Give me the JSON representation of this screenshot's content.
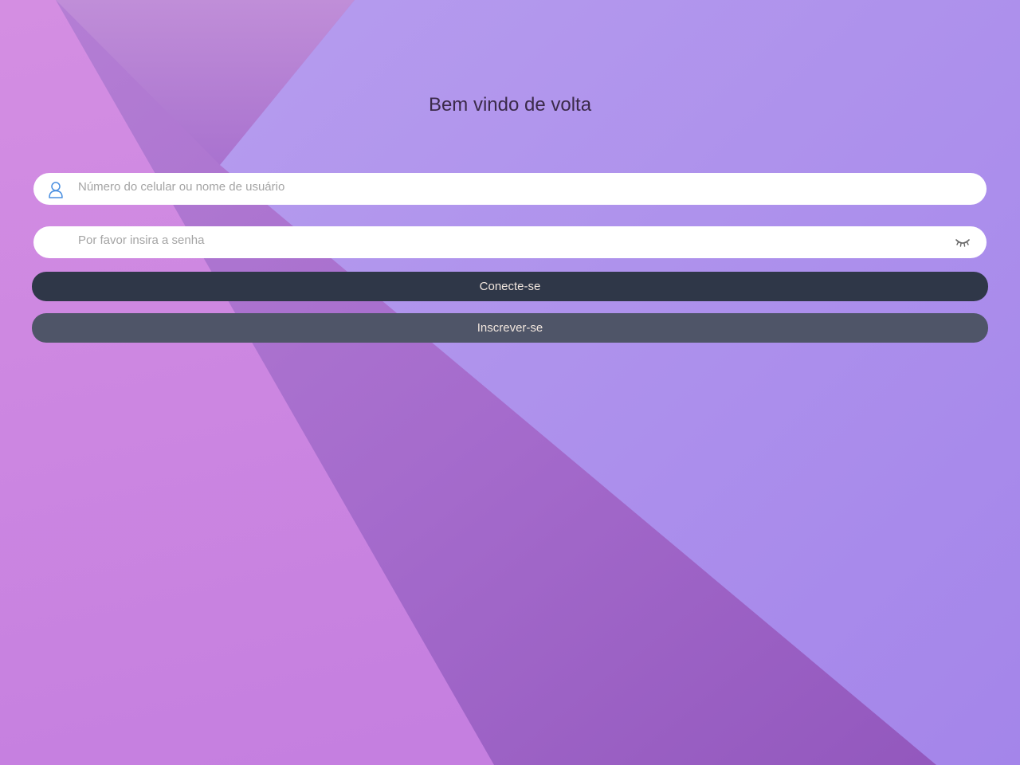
{
  "login": {
    "title": "Bem vindo de volta",
    "username_placeholder": "Número do celular ou nome de usuário",
    "username_value": "",
    "password_placeholder": "Por favor insira a senha",
    "password_value": "",
    "login_label": "Conecte-se",
    "signup_label": "Inscrever-se"
  },
  "icons": {
    "username": "user-icon",
    "password_toggle": "eye-closed-icon"
  },
  "colors": {
    "login_button": "#2f3748",
    "signup_button": "#4f5568",
    "button_text": "#f1e6de",
    "title_text": "#3b2a4a",
    "icon_accent": "#4a8fe0",
    "background_left": "#d08ce0",
    "background_right": "#ad90ec",
    "background_fold": "#9f66c6"
  }
}
